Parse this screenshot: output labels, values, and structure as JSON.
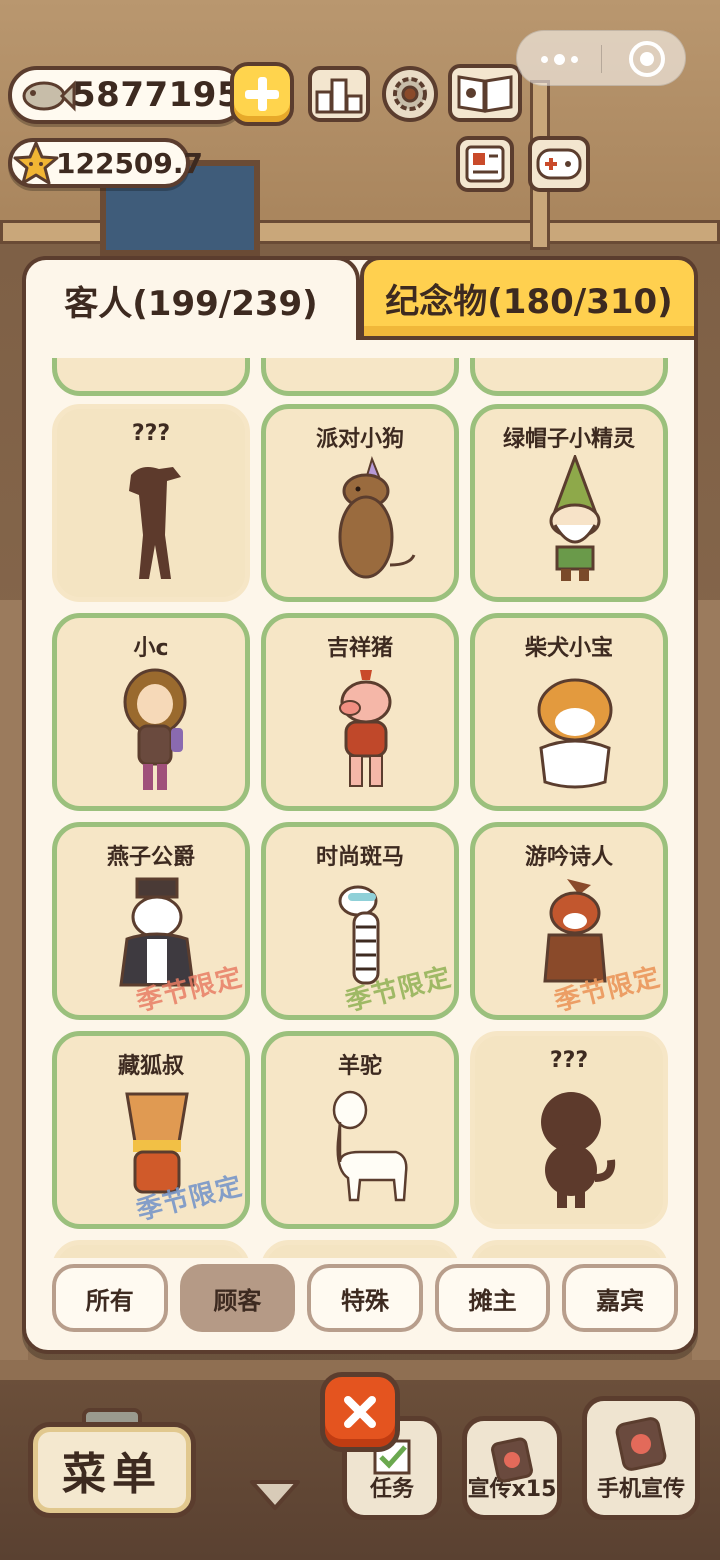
{
  "hud": {
    "fish_coins": "5877195",
    "stars": "122509.7",
    "icons": [
      "fish-icon",
      "star-icon",
      "plus-icon",
      "ranking-icon",
      "settings-icon",
      "book-icon",
      "news-icon",
      "gamepad-icon",
      "more-icon",
      "close-miniprogram-icon"
    ]
  },
  "tabs": [
    {
      "label": "客人(199/239)",
      "active": true
    },
    {
      "label": "纪念物(180/310)",
      "active": false
    }
  ],
  "cards": [
    {
      "name": "",
      "locked": false,
      "limited": ""
    },
    {
      "name": "",
      "locked": false,
      "limited": ""
    },
    {
      "name": "",
      "locked": false,
      "limited": ""
    },
    {
      "name": "???",
      "locked": true,
      "limited": ""
    },
    {
      "name": "派对小狗",
      "locked": false,
      "limited": ""
    },
    {
      "name": "绿帽子小精灵",
      "locked": false,
      "limited": ""
    },
    {
      "name": "小c",
      "locked": false,
      "limited": ""
    },
    {
      "name": "吉祥猪",
      "locked": false,
      "limited": ""
    },
    {
      "name": "柴犬小宝",
      "locked": false,
      "limited": ""
    },
    {
      "name": "燕子公爵",
      "locked": false,
      "limited": "季节限定"
    },
    {
      "name": "时尚斑马",
      "locked": false,
      "limited": "季节限定"
    },
    {
      "name": "游吟诗人",
      "locked": false,
      "limited": "季节限定"
    },
    {
      "name": "藏狐叔",
      "locked": false,
      "limited": "季节限定"
    },
    {
      "name": "羊驼",
      "locked": false,
      "limited": ""
    },
    {
      "name": "???",
      "locked": true,
      "limited": ""
    }
  ],
  "filters": [
    {
      "label": "所有",
      "active": false
    },
    {
      "label": "顾客",
      "active": true
    },
    {
      "label": "特殊",
      "active": false
    },
    {
      "label": "摊主",
      "active": false
    },
    {
      "label": "嘉宾",
      "active": false
    }
  ],
  "bottom": {
    "menu_label": "菜单",
    "task_label": "任务",
    "promo_label": "宣传x15",
    "phone_label": "手机宣传"
  },
  "colors": {
    "card_border": "#9bc07d",
    "card_fill": "#f6e6c6",
    "active_tab": "#fdf6ea",
    "inactive_tab": "#ffd04f",
    "close_button": "#e4541f",
    "outline": "#5b3d2e"
  }
}
